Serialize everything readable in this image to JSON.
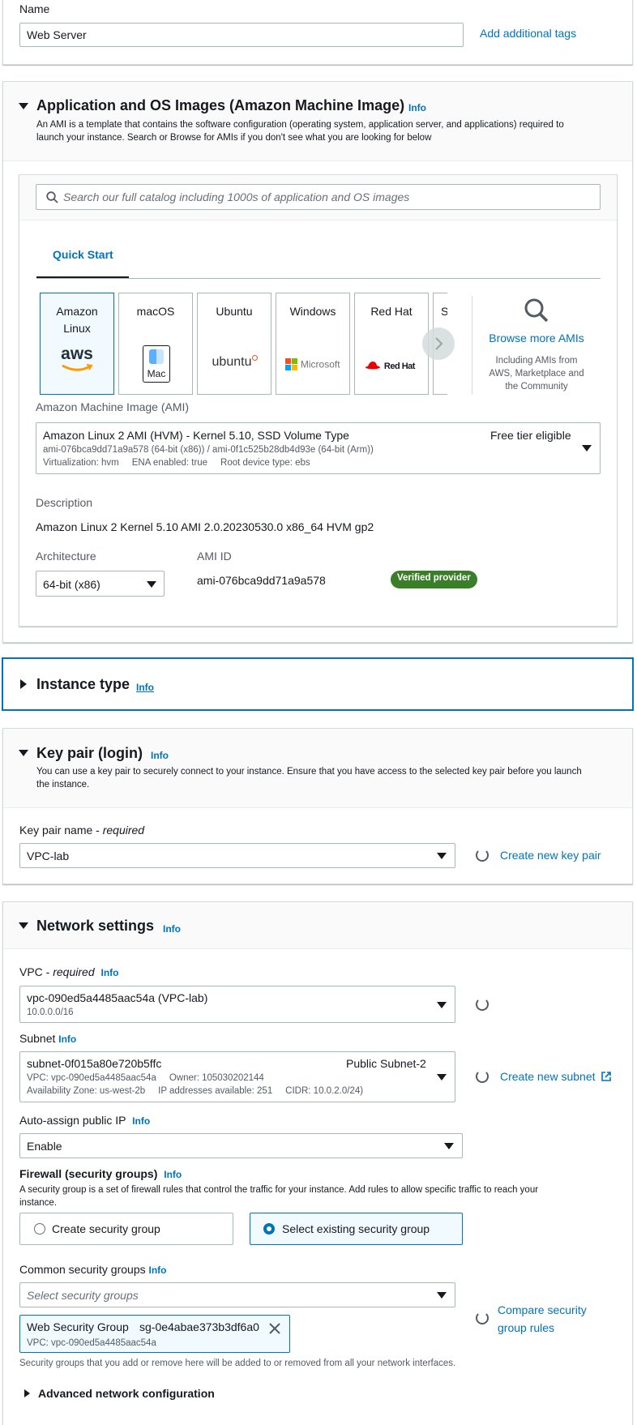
{
  "name": {
    "label": "Name",
    "value": "Web Server",
    "add_tags": "Add additional tags"
  },
  "ami_section": {
    "title": "Application and OS Images (Amazon Machine Image)",
    "info": "Info",
    "description_line1": "An AMI is a template that contains the software configuration (operating system, application server, and applications) required to",
    "description_line2": "launch your instance. Search or Browse for AMIs if you don't see what you are looking for below",
    "search_placeholder": "Search our full catalog including 1000s of application and OS images",
    "tab_quick_start": "Quick Start",
    "tiles": [
      {
        "label_line1": "Amazon",
        "label_line2": "Linux",
        "logo": "aws"
      },
      {
        "label_line1": "macOS",
        "label_line2": "",
        "logo": "Mac"
      },
      {
        "label_line1": "Ubuntu",
        "label_line2": "",
        "logo": "ubuntu"
      },
      {
        "label_line1": "Windows",
        "label_line2": "",
        "logo": "Microsoft"
      },
      {
        "label_line1": "Red Hat",
        "label_line2": "",
        "logo": "Red Hat"
      },
      {
        "label_line1": "S",
        "label_line2": "",
        "logo": ""
      }
    ],
    "browse_more": "Browse more AMIs",
    "browse_sub_1": "Including AMIs from",
    "browse_sub_2": "AWS, Marketplace and",
    "browse_sub_3": "the Community",
    "ami_label": "Amazon Machine Image (AMI)",
    "ami_name": "Amazon Linux 2 AMI (HVM) - Kernel 5.10, SSD Volume Type",
    "ami_badge": "Free tier eligible",
    "ami_ids": "ami-076bca9dd71a9a578 (64-bit (x86)) / ami-0f1c525b28db4d93e (64-bit (Arm))",
    "ami_meta": "Virtualization: hvm     ENA enabled: true     Root device type: ebs",
    "description_label": "Description",
    "description_value": "Amazon Linux 2 Kernel 5.10 AMI 2.0.20230530.0 x86_64 HVM gp2",
    "architecture_label": "Architecture",
    "architecture_value": "64-bit (x86)",
    "ami_id_label": "AMI ID",
    "ami_id_value": "ami-076bca9dd71a9a578",
    "verified": "Verified provider"
  },
  "instance_type": {
    "title": "Instance type",
    "info": "Info"
  },
  "key_pair": {
    "title": "Key pair (login)",
    "info": "Info",
    "desc_line1": "You can use a key pair to securely connect to your instance. Ensure that you have access to the selected key pair before you launch",
    "desc_line2": "the instance.",
    "name_label": "Key pair name - ",
    "name_required": "required",
    "value": "VPC-lab",
    "create": "Create new key pair"
  },
  "network": {
    "title": "Network settings",
    "info": "Info",
    "vpc_label": "VPC - ",
    "vpc_required": "required",
    "vpc_value": "vpc-090ed5a4485aac54a (VPC-lab)",
    "vpc_cidr": "10.0.0.0/16",
    "subnet_label": "Subnet",
    "subnet_value": "subnet-0f015a80e720b5ffc",
    "subnet_name": "Public Subnet-2",
    "subnet_line2": "VPC: vpc-090ed5a4485aac54a     Owner: 105030202144",
    "subnet_line3": "Availability Zone: us-west-2b     IP addresses available: 251     CIDR: 10.0.2.0/24)",
    "create_subnet": "Create new subnet",
    "public_ip_label": "Auto-assign public IP",
    "public_ip_value": "Enable",
    "firewall_label": "Firewall (security groups)",
    "firewall_desc1": "A security group is a set of firewall rules that control the traffic for your instance. Add rules to allow specific traffic to reach your",
    "firewall_desc2": "instance.",
    "opt_create": "Create security group",
    "opt_select": "Select existing security group",
    "common_label": "Common security groups",
    "common_placeholder": "Select security groups",
    "token_name": "Web Security Group",
    "token_id": "sg-0e4abae373b3df6a0",
    "token_vpc": "VPC: vpc-090ed5a4485aac54a",
    "compare_1": "Compare security",
    "compare_2": "group rules",
    "sg_note": "Security groups that you add or remove here will be added to or removed from all your network interfaces.",
    "advanced": "Advanced network configuration"
  }
}
